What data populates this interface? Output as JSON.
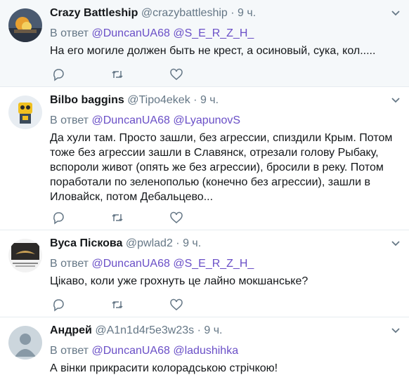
{
  "tweets": [
    {
      "name": "Crazy Battleship",
      "handle": "@crazybattleship",
      "dot": "·",
      "time": "9 ч.",
      "reply_prefix": "В ответ",
      "mentions": [
        "@DuncanUA68",
        "@S_E_R_Z_H_"
      ],
      "text": "На его могиле должен быть не крест, а осиновый, сука, кол.....",
      "avatar_icon": "battleship-photo-avatar"
    },
    {
      "name": "Bilbo baggins",
      "handle": "@Tipo4ekek",
      "dot": "·",
      "time": "9 ч.",
      "reply_prefix": "В ответ",
      "mentions": [
        "@DuncanUA68",
        "@LyapunovS"
      ],
      "text": "Да хули там. Просто зашли, без агрессии, спиздили Крым. Потом тоже без агрессии зашли в Славянск, отрезали голову Рыбаку, вспороли живот (опять же без агрессии), бросили в реку. Потом поработали по зеленополью (конечно без агрессии), зашли в Иловайск, потом Дебальцево...",
      "avatar_icon": "robot-avatar"
    },
    {
      "name": "Вуса Піскова",
      "handle": "@pwlad2",
      "dot": "·",
      "time": "9 ч.",
      "reply_prefix": "В ответ",
      "mentions": [
        "@DuncanUA68",
        "@S_E_R_Z_H_"
      ],
      "text": "Цікаво, коли уже грохнуть це лайно мокшанське?",
      "avatar_icon": "mustache-photo-avatar"
    },
    {
      "name": "Андрей",
      "handle": "@A1n1d4r5e3w23s",
      "dot": "·",
      "time": "9 ч.",
      "reply_prefix": "В ответ",
      "mentions": [
        "@DuncanUA68",
        "@ladushihka"
      ],
      "text": "А вінки прикрасити колорадською стрічкою!",
      "avatar_icon": "default-user-avatar"
    }
  ],
  "colors": {
    "mention": "#6a4fc7",
    "secondary_text": "#657786",
    "highlight_bg": "#f5f8fa",
    "divider": "#e6ecf0"
  }
}
